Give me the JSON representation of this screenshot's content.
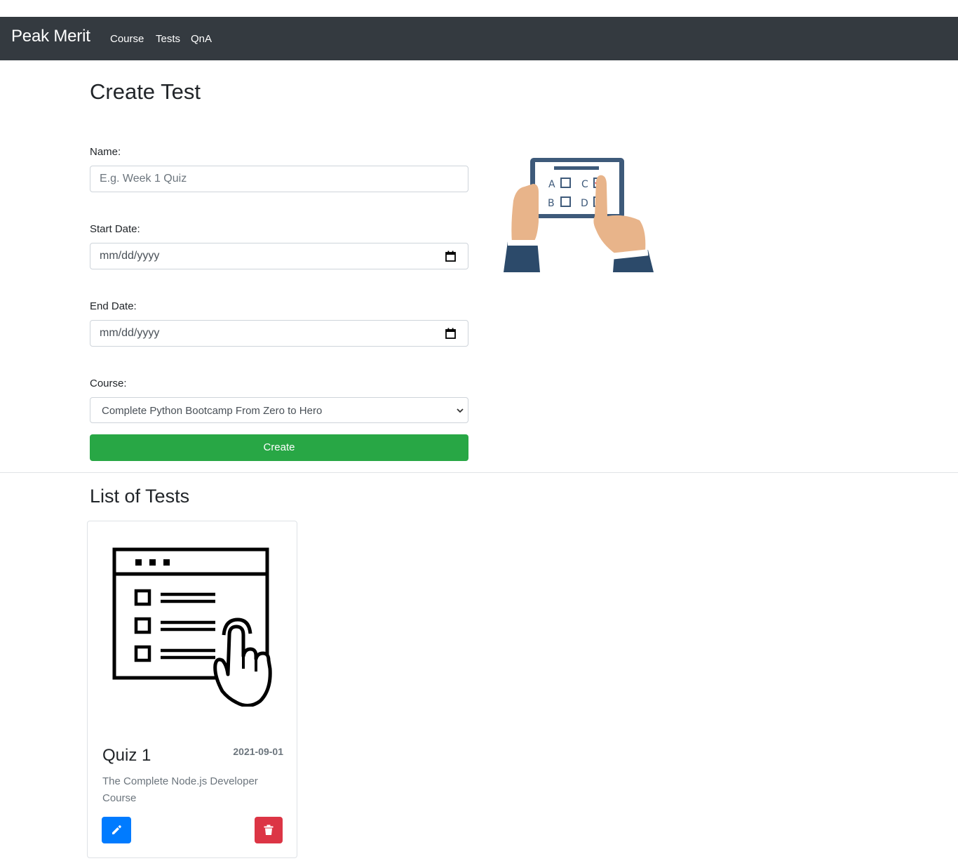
{
  "nav": {
    "brand": "Peak Merit",
    "links": [
      "Course",
      "Tests",
      "QnA"
    ]
  },
  "create_form": {
    "title": "Create Test",
    "name_label": "Name:",
    "name_placeholder": "E.g. Week 1 Quiz",
    "start_date_label": "Start Date:",
    "start_date_value": "mm/dd/yyyy",
    "end_date_label": "End Date:",
    "end_date_value": "mm/dd/yyyy",
    "course_label": "Course:",
    "course_selected": "Complete Python Bootcamp From Zero to Hero",
    "create_button": "Create"
  },
  "illustration": {
    "option_a": "A",
    "option_b": "B",
    "option_c": "C",
    "option_d": "D"
  },
  "list": {
    "title": "List of Tests",
    "tests": [
      {
        "name": "Quiz 1",
        "date": "2021-09-01",
        "course": "The Complete Node.js Developer Course"
      }
    ]
  },
  "colors": {
    "navbar": "#343a40",
    "success": "#28a745",
    "primary": "#007bff",
    "danger": "#dc3545"
  },
  "icons": {
    "date": "calendar-icon",
    "select": "chevron-down-icon",
    "edit": "pencil-icon",
    "delete": "trash-icon"
  }
}
